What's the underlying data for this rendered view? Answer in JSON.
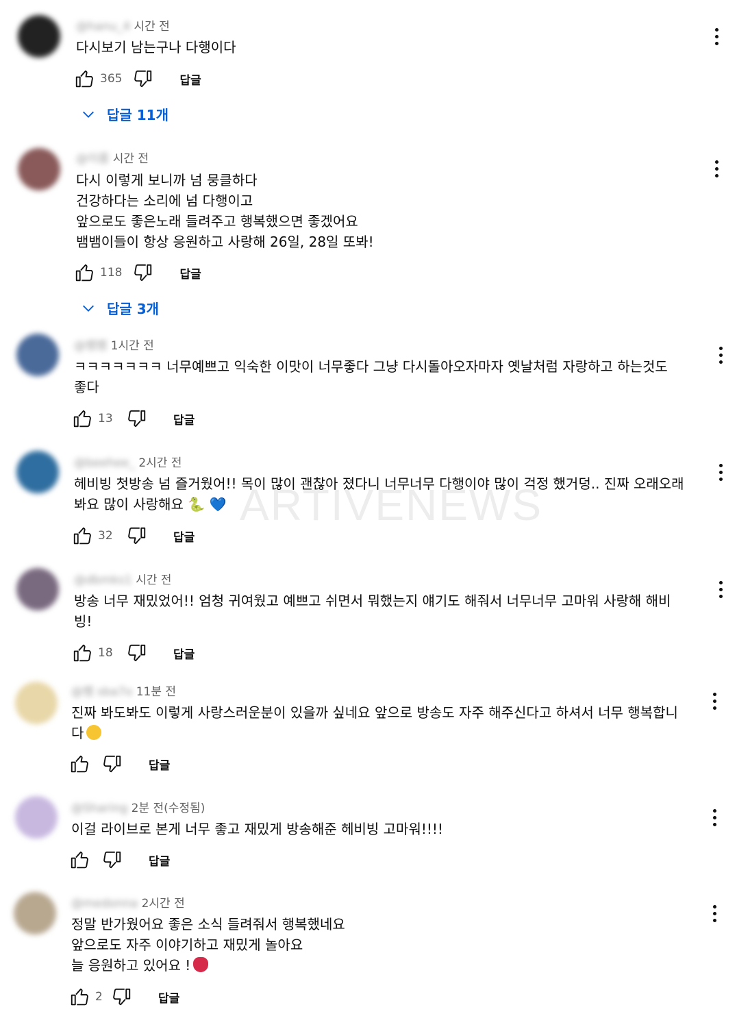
{
  "reply_label": "답글",
  "watermark": "ARTIVENEWS",
  "comments": [
    {
      "handle": "@hanu_4",
      "time": "시간 전",
      "text": "다시보기 남는구나 다행이다",
      "likes": "365",
      "replies": "답글 11개",
      "avatar_color": "#222222"
    },
    {
      "handle": "@이름",
      "time": "시간 전",
      "text": "다시 이렇게 보니까 넘 뭉클하다\n건강하다는 소리에 넘 다행이고\n앞으로도 좋은노래 들려주고 행복했으면 좋겠어요\n뱀뱀이들이 항상 응원하고 사랑해 26일, 28일 또봐!",
      "likes": "118",
      "replies": "답글 3개",
      "avatar_color": "#8a5a5a"
    },
    {
      "handle": "@뱀뱀",
      "time": "1시간 전",
      "text": "ㅋㅋㅋㅋㅋㅋㅋ 너무예쁘고 익숙한 이맛이 너무좋다 그냥 다시돌아오자마자 옛날처럼 자랑하고 하는것도\n좋다",
      "likes": "13",
      "replies": "",
      "avatar_color": "#4a6a9a"
    },
    {
      "handle": "@beehee_",
      "time": "2시간 전",
      "text": "헤비빙 첫방송 넘 즐거웠어!! 목이 많이 괜찮아 졌다니 너무너무 다행이야 많이 걱정 했거덩.. 진짜 오래오래\n봐요 많이 사랑해요 🐍 💙",
      "likes": "32",
      "replies": "",
      "avatar_color": "#2f6ea0"
    },
    {
      "handle": "@dbmks1",
      "time": "시간 전",
      "text": "방송 너무 재밌었어!! 엄청 귀여웠고 예쁘고 쉬면서 뭐했는지 얘기도 해줘서 너무너무 고마워 사랑해 해비\n빙!",
      "likes": "18",
      "replies": "",
      "avatar_color": "#7a6a80"
    },
    {
      "handle": "@뱀 sba7o",
      "time": "11분 전",
      "text": "진짜 봐도봐도 이렇게 사랑스러운분이 있을까 싶네요 앞으로 방송도 자주 해주신다고 하셔서 너무 행복합니\n다",
      "likes": "",
      "replies": "",
      "avatar_color": "#e8d7a8"
    },
    {
      "handle": "@Sharing",
      "time": "2분 전(수정됨)",
      "text": "이걸 라이브로 본게 너무 좋고 재밌게 방송해준 헤비빙 고마워!!!!",
      "likes": "",
      "replies": "",
      "avatar_color": "#c8b8e0"
    },
    {
      "handle": "@medonna",
      "time": "2시간 전",
      "text": "정말 반가웠어요 좋은 소식 들려줘서 행복했네요\n앞으로도 자주 이야기하고 재밌게 놀아요\n늘 응원하고 있어요 !",
      "likes": "2",
      "replies": "",
      "avatar_color": "#b8a890"
    }
  ]
}
